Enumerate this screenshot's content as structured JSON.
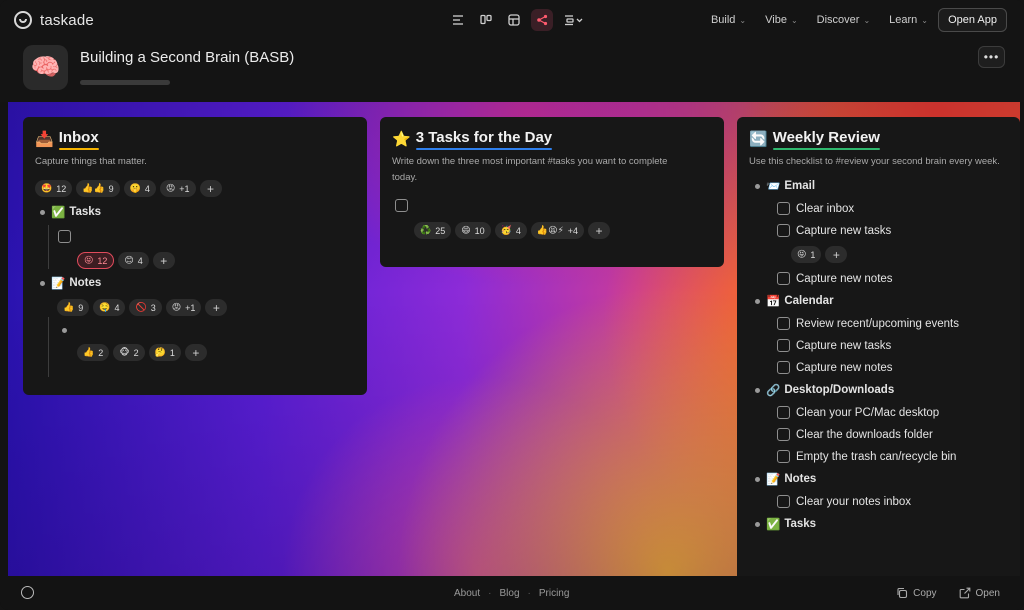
{
  "app": {
    "brand": "taskade"
  },
  "nav": {
    "links": [
      {
        "label": "Build"
      },
      {
        "label": "Vibe"
      },
      {
        "label": "Discover"
      },
      {
        "label": "Learn"
      }
    ],
    "open_app_label": "Open App"
  },
  "project": {
    "title": "Building a Second Brain (BASB)",
    "icon": "🧠"
  },
  "inbox": {
    "emoji": "📥",
    "title": "Inbox",
    "desc": "Capture things that matter.",
    "reactions": [
      {
        "e": "🤩",
        "n": "12"
      },
      {
        "e": "👍👍",
        "n": "9"
      },
      {
        "e": "🤫",
        "n": "4"
      },
      {
        "e": "😡",
        "n": "+1"
      }
    ],
    "tasks_label": "Tasks",
    "tasks_emoji": "✅",
    "tasks_reactions": [
      {
        "e": "😝",
        "n": "12"
      },
      {
        "e": "😊",
        "n": "4"
      }
    ],
    "notes_label": "Notes",
    "notes_emoji": "📝",
    "notes_reactions": [
      {
        "e": "👍",
        "n": "9"
      },
      {
        "e": "🤤",
        "n": "4"
      },
      {
        "e": "🚫",
        "n": "3"
      },
      {
        "e": "😡",
        "n": "+1"
      }
    ],
    "sub_reactions": [
      {
        "e": "👍",
        "n": "2"
      },
      {
        "e": "🐵",
        "n": "2"
      },
      {
        "e": "🤔",
        "n": "1"
      }
    ]
  },
  "three_tasks": {
    "emoji": "⭐",
    "title": "3 Tasks for the Day",
    "desc": "Write down the three most important #tasks you want to complete today.",
    "reactions": [
      {
        "e": "♻️",
        "n": "25"
      },
      {
        "e": "😄",
        "n": "10"
      },
      {
        "e": "🥳",
        "n": "4"
      },
      {
        "e": "👍😫⚡",
        "n": "+4"
      }
    ]
  },
  "weekly": {
    "emoji": "🔄",
    "title": "Weekly Review",
    "desc": "Use this checklist to #review your second brain every week.",
    "email_label": "Email",
    "email_emoji": "📨",
    "email_items": [
      "Clear inbox",
      "Capture new tasks",
      "Capture new notes"
    ],
    "email_reaction": {
      "e": "😝",
      "n": "1"
    },
    "calendar_label": "Calendar",
    "calendar_emoji": "📅",
    "calendar_items": [
      "Review recent/upcoming events",
      "Capture new tasks",
      "Capture new notes"
    ],
    "desktop_label": "Desktop/Downloads",
    "desktop_emoji": "🔗",
    "desktop_items": [
      "Clean your PC/Mac desktop",
      "Clear the downloads folder",
      "Empty the trash can/recycle bin"
    ],
    "notes_label": "Notes",
    "notes_emoji": "📝",
    "notes_items": [
      "Clear your notes inbox"
    ],
    "tasks_label": "Tasks",
    "tasks_emoji": "✅"
  },
  "footer": {
    "links": [
      "About",
      "Blog",
      "Pricing"
    ],
    "copy_label": "Copy",
    "open_label": "Open"
  },
  "colors": {
    "accent": "#ff5b6e",
    "inbox_underline": "#f5b400",
    "tasks_underline": "#2f80ed",
    "weekly_underline": "#2fb86e"
  }
}
